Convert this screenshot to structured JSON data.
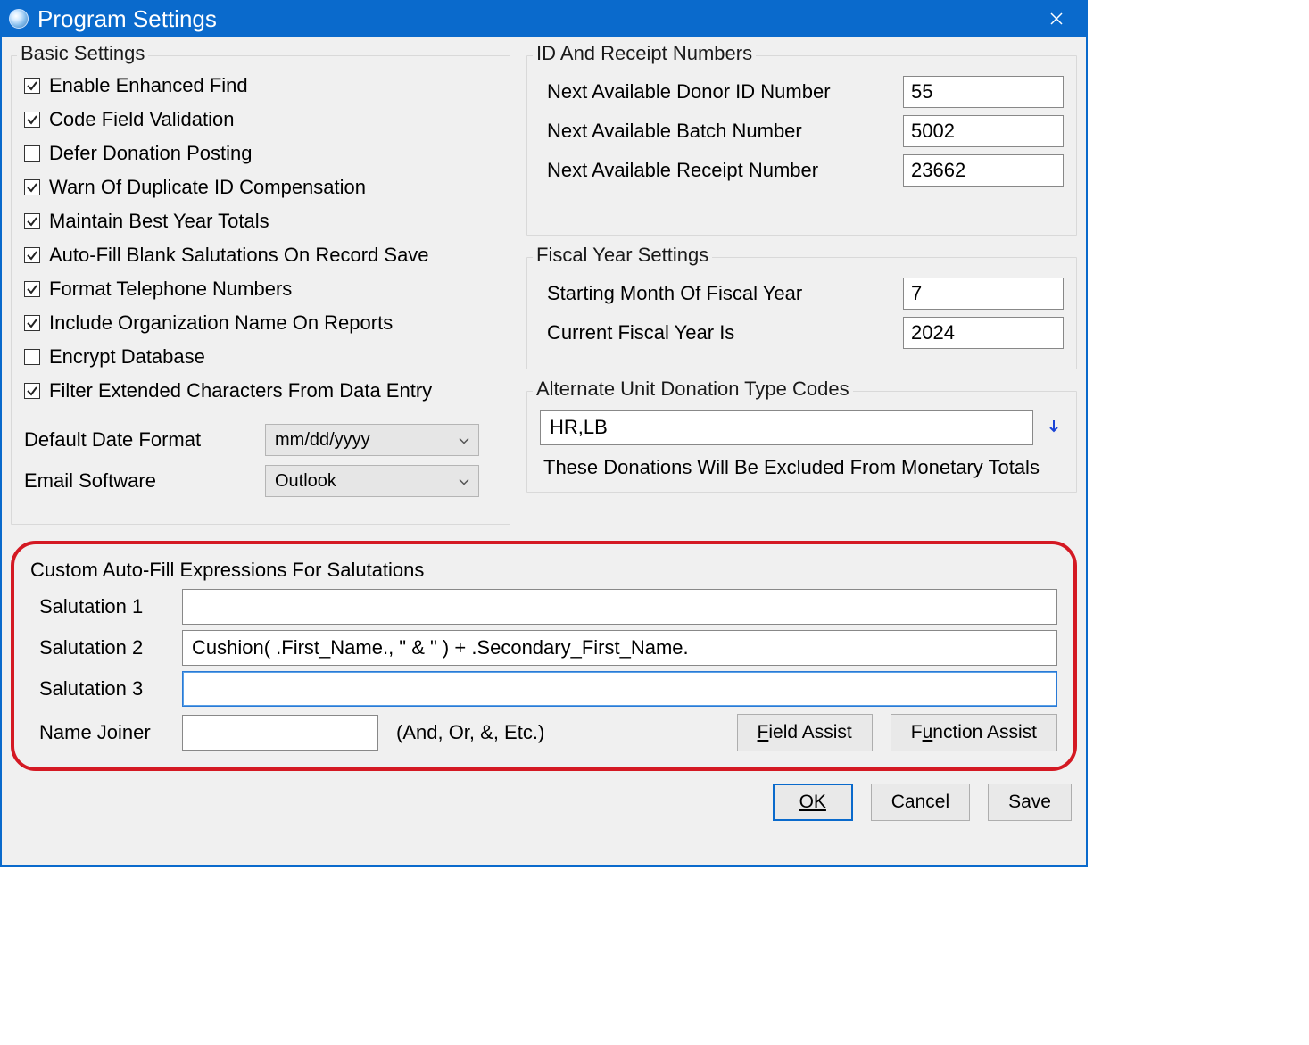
{
  "window": {
    "title": "Program Settings"
  },
  "basic": {
    "title": "Basic Settings",
    "items": [
      {
        "label": "Enable Enhanced Find",
        "checked": true
      },
      {
        "label": "Code Field Validation",
        "checked": true
      },
      {
        "label": "Defer Donation Posting",
        "checked": false
      },
      {
        "label": "Warn Of Duplicate ID Compensation",
        "checked": true
      },
      {
        "label": "Maintain Best Year Totals",
        "checked": true
      },
      {
        "label": "Auto-Fill Blank Salutations On Record Save",
        "checked": true
      },
      {
        "label": "Format Telephone Numbers",
        "checked": true
      },
      {
        "label": "Include Organization Name On Reports",
        "checked": true
      },
      {
        "label": "Encrypt Database",
        "checked": false
      },
      {
        "label": "Filter Extended Characters From Data Entry",
        "checked": true
      }
    ],
    "dateFormat": {
      "label": "Default Date Format",
      "value": "mm/dd/yyyy"
    },
    "emailSoftware": {
      "label": "Email Software",
      "value": "Outlook"
    }
  },
  "idnums": {
    "title": "ID And Receipt Numbers",
    "donor": {
      "label": "Next Available Donor ID Number",
      "value": "55"
    },
    "batch": {
      "label": "Next Available Batch Number",
      "value": "5002"
    },
    "receipt": {
      "label": "Next Available Receipt Number",
      "value": "23662"
    }
  },
  "fiscal": {
    "title": "Fiscal Year Settings",
    "startMonth": {
      "label": "Starting Month Of Fiscal Year",
      "value": "7"
    },
    "currentYear": {
      "label": "Current Fiscal Year Is",
      "value": "2024"
    }
  },
  "altunit": {
    "title": "Alternate Unit Donation Type Codes",
    "value": "HR,LB",
    "note": "These Donations Will Be Excluded From Monetary Totals"
  },
  "salut": {
    "title": "Custom Auto-Fill Expressions For Salutations",
    "s1": {
      "label": "Salutation 1",
      "value": ""
    },
    "s2": {
      "label": "Salutation 2",
      "value": "Cushion( .First_Name., \" & \" ) + .Secondary_First_Name."
    },
    "s3": {
      "label": "Salutation 3",
      "value": ""
    },
    "nj": {
      "label": "Name Joiner",
      "value": "",
      "hint": "(And, Or, &, Etc.)"
    },
    "fieldAssist": "Field Assist",
    "functionAssist": "Function Assist"
  },
  "buttons": {
    "ok": "OK",
    "cancel": "Cancel",
    "save": "Save"
  }
}
